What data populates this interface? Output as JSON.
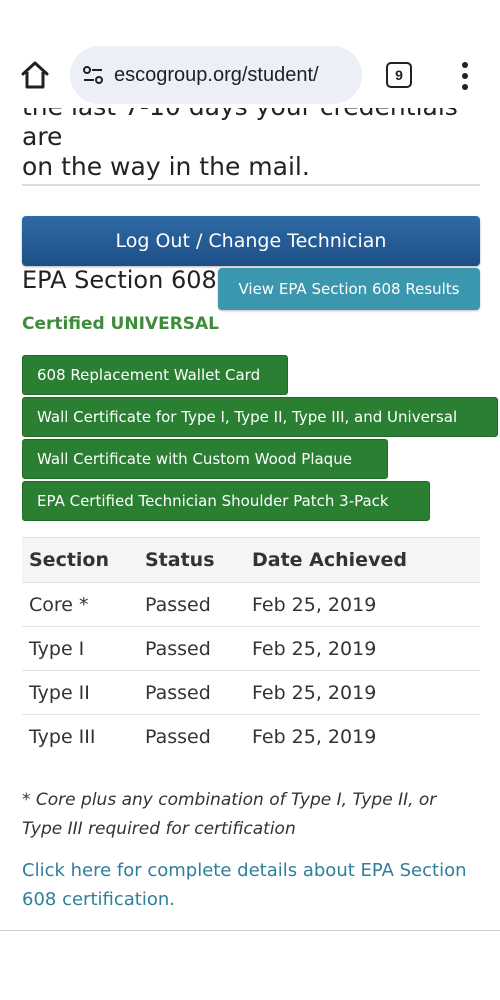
{
  "browser": {
    "url": "escogroup.org/student/",
    "tab_count": "9"
  },
  "page": {
    "cut_off_line": "the last 7-10 days your credentials are",
    "intro_text": "on the way in the mail.",
    "logout_label": "Log Out / Change Technician",
    "section_heading": "EPA Section 608",
    "view_results_label": "View EPA Section 608 Results",
    "certified_label": "Certified UNIVERSAL",
    "buttons": [
      {
        "label": "608 Replacement Wallet Card"
      },
      {
        "label": "Wall Certificate for Type I, Type II, Type III, and Universal"
      },
      {
        "label": "Wall Certificate with Custom Wood Plaque"
      },
      {
        "label": "EPA Certified Technician Shoulder Patch 3-Pack"
      }
    ],
    "table": {
      "headers": [
        "Section",
        "Status",
        "Date Achieved"
      ],
      "rows": [
        [
          "Core *",
          "Passed",
          "Feb 25, 2019"
        ],
        [
          "Type I",
          "Passed",
          "Feb 25, 2019"
        ],
        [
          "Type II",
          "Passed",
          "Feb 25, 2019"
        ],
        [
          "Type III",
          "Passed",
          "Feb 25, 2019"
        ]
      ]
    },
    "footnote": "* Core plus any combination of Type I, Type II, or Type III required for certification",
    "details_link": "Click here for complete details about EPA Section 608 certification."
  },
  "colors": {
    "logout_button": "#1d4f86",
    "view_results_button": "#3a97ad",
    "green_button": "#2a7f32",
    "certified_text": "#3d8c3a",
    "link": "#2e7f9a"
  },
  "icons": {
    "home": "home-icon",
    "site_info": "tune-icon",
    "tabs": "tab-switcher-icon",
    "menu": "more-vert-icon"
  }
}
